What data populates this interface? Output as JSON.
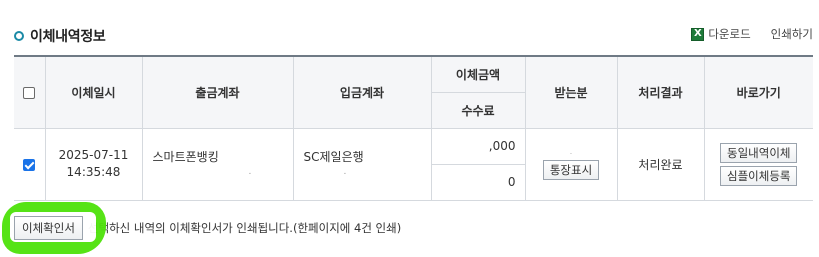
{
  "header": {
    "title": "이체내역정보",
    "download_label": "다운로드",
    "print_label": "인쇄하기",
    "excel_icon_glyph": "X"
  },
  "table": {
    "col_select": "",
    "col_datetime": "이체일시",
    "col_from_account": "출금계좌",
    "col_to_account": "입금계좌",
    "col_amount": "이체금액",
    "col_fee": "수수료",
    "col_receiver": "받는분",
    "col_result": "처리결과",
    "col_goto": "바로가기",
    "rows": [
      {
        "checked": true,
        "date": "2025-07-11",
        "time": "14:35:48",
        "from_account": "스마트폰뱅킹",
        "from_account_sub": ".",
        "to_account": "SC제일은행",
        "to_account_sub": ".",
        "amount": ",000",
        "fee": "0",
        "receiver_name": ".",
        "passbook_button": "통장표시",
        "result": "처리완료",
        "same_transfer_button": "동일내역이체",
        "simple_register_button": "심플이체등록"
      }
    ]
  },
  "footer": {
    "confirm_button": "이체확인서",
    "description": "선택하신 내역의 이체확인서가 인쇄됩니다.(한페이지에 4건 인쇄)"
  },
  "colors": {
    "accent": "#1b8aa6",
    "checkbox_checked": "#1a73e8",
    "highlight": "#4ee20a",
    "excel_green": "#1e7b3a"
  }
}
